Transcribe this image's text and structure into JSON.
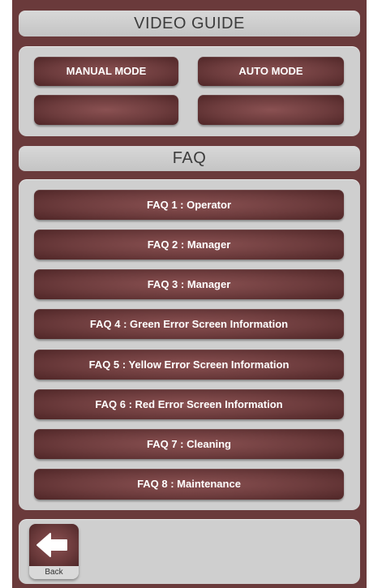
{
  "video_guide": {
    "title": "VIDEO GUIDE",
    "buttons": [
      {
        "label": "MANUAL MODE"
      },
      {
        "label": "AUTO MODE"
      },
      {
        "label": ""
      },
      {
        "label": ""
      }
    ]
  },
  "faq": {
    "title": "FAQ",
    "items": [
      {
        "label": "FAQ 1 : Operator"
      },
      {
        "label": "FAQ 2 : Manager"
      },
      {
        "label": "FAQ 3 : Manager"
      },
      {
        "label": "FAQ 4 : Green Error Screen Information"
      },
      {
        "label": "FAQ 5 : Yellow Error Screen Information"
      },
      {
        "label": "FAQ 6 : Red Error Screen Information"
      },
      {
        "label": "FAQ 7 : Cleaning"
      },
      {
        "label": "FAQ 8 : Maintenance"
      }
    ]
  },
  "footer": {
    "back_label": "Back",
    "back_icon": "arrow-left-icon"
  },
  "colors": {
    "frame": "#6a3a3b",
    "panel": "#cfcfcf",
    "button": "#6d3c3d",
    "button_text": "#ffffff"
  }
}
